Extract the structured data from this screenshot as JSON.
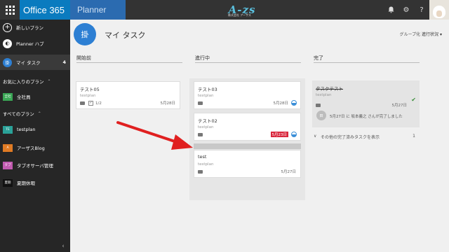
{
  "header": {
    "suite_title": "Office 365",
    "app_title": "Planner",
    "logo_text": "A-zs",
    "logo_sub": "株式会社 アーザス"
  },
  "sidebar": {
    "new_plan": "新しいプラン",
    "planner_hub": "Planner ハブ",
    "my_tasks": "マイ タスク",
    "my_tasks_count": "4",
    "favorites_heading": "お気に入りのプラン",
    "favorites": [
      {
        "tile": "全社",
        "label": "全社員",
        "color": "#3aa655"
      }
    ],
    "all_plans_heading": "すべてのプラン",
    "plans": [
      {
        "tile": "TE",
        "label": "testplan",
        "color": "#2aa198"
      },
      {
        "tile": "A",
        "label": "アーザスBlog",
        "color": "#e07b24"
      },
      {
        "tile": "タブ",
        "label": "タブオサーバ管理",
        "color": "#c25bb0"
      },
      {
        "tile": "夏期",
        "label": "夏期休暇",
        "color": "#111111"
      }
    ]
  },
  "main": {
    "plan_icon": "掛",
    "title": "マイ タスク",
    "group_by_label": "グループ化",
    "group_by_value": "進行状況 ▾",
    "columns": [
      {
        "label": "開始前"
      },
      {
        "label": "進行中"
      },
      {
        "label": "完了"
      }
    ],
    "not_started": [
      {
        "title": "テスト05",
        "plan": "testplan",
        "checklist": "1/2",
        "date": "5月28日"
      }
    ],
    "in_progress": [
      {
        "title": "テスト03",
        "plan": "testplan",
        "date": "5月28日"
      },
      {
        "title": "テスト02",
        "plan": "testplan",
        "date": "5月23日"
      },
      {
        "title": "test",
        "plan": "testplan",
        "date": "5月27日"
      }
    ],
    "completed": {
      "title": "タスクテスト",
      "plan": "testplan",
      "date": "5月27日",
      "avatar": "田",
      "note": "5月27日 に 坂本義之 さんが完了しました",
      "show_completed": "その他の完了済みタスクを表示",
      "show_completed_count": "1"
    }
  }
}
